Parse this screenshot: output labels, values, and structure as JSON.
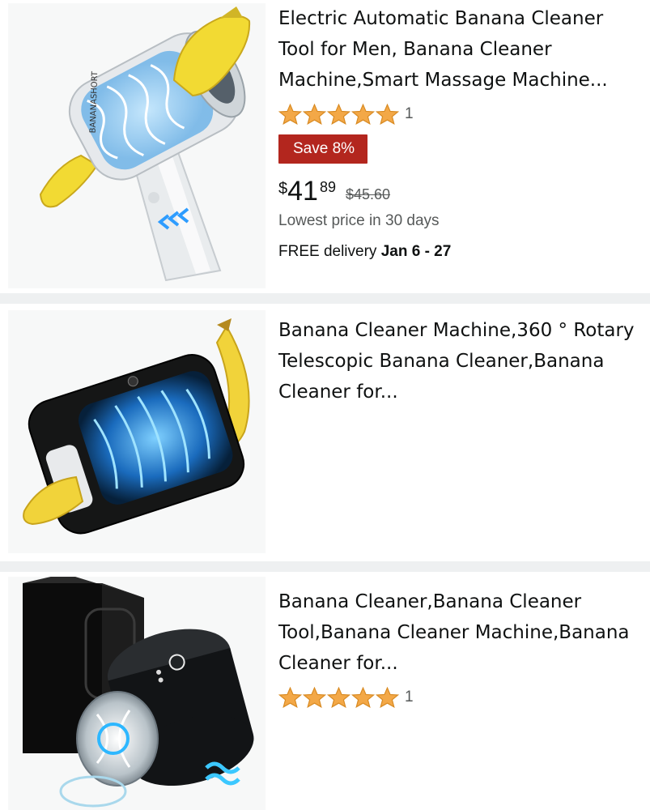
{
  "products": [
    {
      "title": "Electric Automatic Banana Cleaner Tool for Men, Banana Cleaner Machine,Smart Massage Machine...",
      "rating_count": "1",
      "stars": 5,
      "badge": "Save 8%",
      "price": {
        "currency": "$",
        "whole": "41",
        "fraction": "89"
      },
      "list_price": "$45.60",
      "lowest_price_note": "Lowest price in 30 days",
      "delivery_prefix": "FREE delivery ",
      "delivery_dates": "Jan 6 - 27",
      "image": {
        "brand_text": "BANANASHORT",
        "alt": "white handheld device with banana"
      }
    },
    {
      "title": "Banana Cleaner Machine,360 ° Rotary Telescopic Banana Cleaner,Banana Cleaner for...",
      "image": {
        "alt": "black rectangular device with banana"
      }
    },
    {
      "title": "Banana Cleaner,Banana Cleaner Tool,Banana Cleaner Machine,Banana Cleaner for...",
      "rating_count": "1",
      "stars": 5,
      "image": {
        "alt": "black cylindrical device with box"
      }
    }
  ],
  "colors": {
    "star": "#f3a847",
    "badge": "#b3261e",
    "text": "#0f1111",
    "muted": "#565959",
    "glow": "#2d9cff"
  },
  "icons": [
    "star-icon"
  ]
}
